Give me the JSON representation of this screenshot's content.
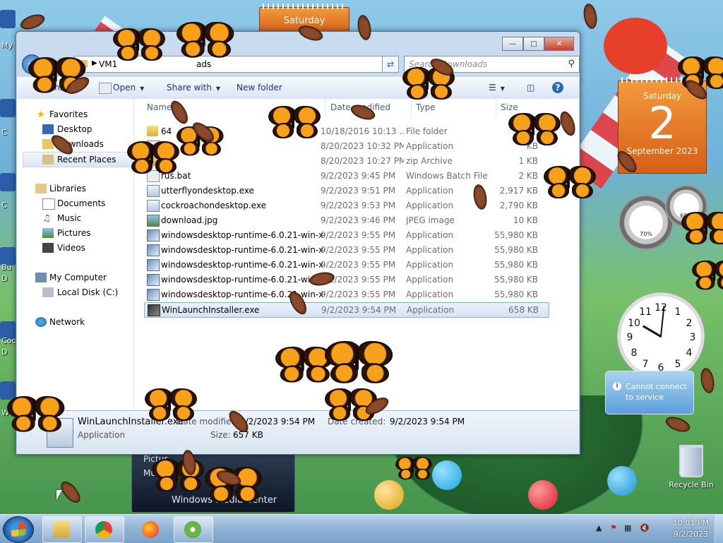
{
  "desktop": {
    "left_edge_labels": [
      "My",
      "C",
      "C",
      "Bu",
      "D",
      "Coc",
      "D",
      "W"
    ],
    "calendar_small": {
      "text": "Saturday"
    },
    "calendar_big": {
      "weekday": "Saturday",
      "day": "2",
      "month_year": "September 2023"
    },
    "meter_cpu_pct": "70%",
    "meter_ram_pct": "60%",
    "clock": {
      "hour": 10,
      "minute": 1
    },
    "news_gadget": {
      "line1": "Cannot connect",
      "line2": "to service"
    },
    "recycle_bin_label": "Recycle Bin",
    "media_tile": {
      "line1": "Pictur",
      "line2": "Mus",
      "line3": "Windows Media Center"
    }
  },
  "explorer": {
    "address": {
      "segment1": "VM1",
      "segment2": "ads"
    },
    "search_placeholder": "Search Downloads",
    "toolbar": {
      "organize": "Organize",
      "open": "Open",
      "share_with": "Share with",
      "new_folder": "New folder"
    },
    "nav": {
      "favorites": "Favorites",
      "desktop": "Desktop",
      "downloads": "Downloads",
      "recent_places": "Recent Places",
      "libraries": "Libraries",
      "documents": "Documents",
      "music": "Music",
      "pictures": "Pictures",
      "videos": "Videos",
      "my_computer": "My Computer",
      "local_disk": "Local Disk (C:)",
      "network": "Network"
    },
    "columns": {
      "name": "Name",
      "date": "Date modified",
      "type": "Type",
      "size": "Size"
    },
    "files": [
      {
        "name": "64",
        "date": "10/18/2016 10:13 ...",
        "type": "File folder",
        "size": "",
        "icon": "folder-icon"
      },
      {
        "name": "",
        "date": "8/20/2023 10:32 PM",
        "type": "Application",
        "size": "KB",
        "icon": "app-icon"
      },
      {
        "name": "",
        "date": "8/20/2023 10:27 PM",
        "type": "zip Archive",
        "size": "1 KB",
        "icon": "zip-icon"
      },
      {
        "name": "rus.bat",
        "date": "9/2/2023 9:45 PM",
        "type": "Windows Batch File",
        "size": "2 KB",
        "icon": "batch-file-icon"
      },
      {
        "name": "utterflyondesktop.exe",
        "date": "9/2/2023 9:51 PM",
        "type": "Application",
        "size": "2,917 KB",
        "icon": "app-icon"
      },
      {
        "name": "cockroachondesktop.exe",
        "date": "9/2/2023 9:53 PM",
        "type": "Application",
        "size": "2,790 KB",
        "icon": "app-icon"
      },
      {
        "name": "download.jpg",
        "date": "9/2/2023 9:46 PM",
        "type": "JPEG image",
        "size": "10 KB",
        "icon": "jpeg-icon"
      },
      {
        "name": "windowsdesktop-runtime-6.0.21-win-x64...",
        "date": "9/2/2023 9:55 PM",
        "type": "Application",
        "size": "55,980 KB",
        "icon": "installer-icon"
      },
      {
        "name": "windowsdesktop-runtime-6.0.21-win-x64...",
        "date": "9/2/2023 9:55 PM",
        "type": "Application",
        "size": "55,980 KB",
        "icon": "installer-icon"
      },
      {
        "name": "windowsdesktop-runtime-6.0.21-win-x64...",
        "date": "9/2/2023 9:55 PM",
        "type": "Application",
        "size": "55,980 KB",
        "icon": "installer-icon"
      },
      {
        "name": "windowsdesktop-runtime-6.0.21-win-x64...",
        "date": "9/2/2023 9:55 PM",
        "type": "Application",
        "size": "55,980 KB",
        "icon": "installer-icon"
      },
      {
        "name": "windowsdesktop-runtime-6.0.21-win-x64...",
        "date": "9/2/2023 9:55 PM",
        "type": "Application",
        "size": "55,980 KB",
        "icon": "installer-icon"
      },
      {
        "name": "WinLaunchInstaller.exe",
        "date": "9/2/2023 9:54 PM",
        "type": "Application",
        "size": "658 KB",
        "icon": "winlaunch-icon"
      }
    ],
    "details_pane": {
      "filename": "WinLaunchInstaller.exe",
      "date_modified_label": "Date modified:",
      "date_modified": "9/2/2023 9:54 PM",
      "date_created_label": "Date created:",
      "date_created": "9/2/2023 9:54 PM",
      "type": "Application",
      "size_label": "Size:",
      "size": "657 KB"
    }
  },
  "taskbar": {
    "time": "10:01 PM",
    "date": "9/2/2023",
    "apps": [
      "explorer-icon",
      "chrome-icon",
      "firefox-icon",
      "winlaunch-icon"
    ]
  }
}
